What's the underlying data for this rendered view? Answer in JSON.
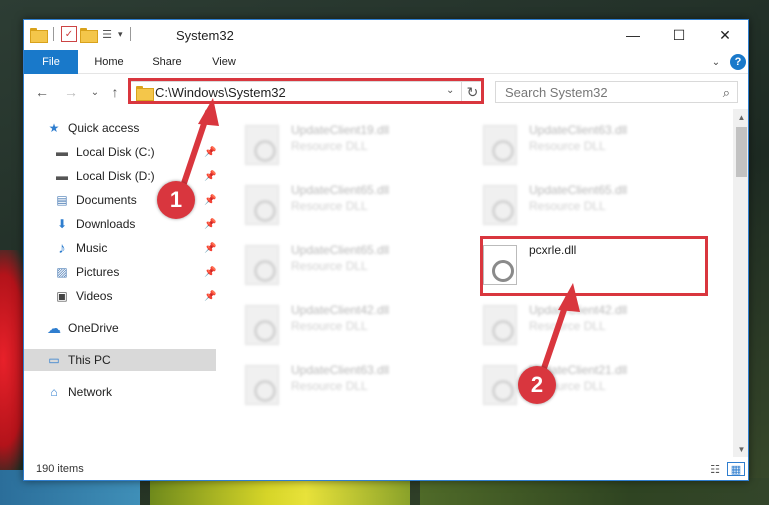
{
  "window": {
    "title": "System32",
    "controls": {
      "minimize": "—",
      "maximize": "☐",
      "close": "✕"
    }
  },
  "ribbon": {
    "tabs": [
      "File",
      "Home",
      "Share",
      "View"
    ],
    "expand": "⌄",
    "help": "?"
  },
  "navbar": {
    "back": "←",
    "forward": "→",
    "recent": "⌄",
    "up": "↑",
    "address": "C:\\Windows\\System32",
    "address_dropdown": "⌄",
    "refresh": "↻",
    "search_placeholder": "Search System32",
    "search_icon": "⌕"
  },
  "sidebar": {
    "items": [
      {
        "label": "Quick access",
        "icon": "star-icon",
        "glyph": "★",
        "color": "#2f7ecf",
        "pinned": false
      },
      {
        "label": "Local Disk (C:)",
        "icon": "disk-icon",
        "glyph": "▬",
        "color": "#555555",
        "pinned": true
      },
      {
        "label": "Local Disk (D:)",
        "icon": "disk-icon",
        "glyph": "▬",
        "color": "#555555",
        "pinned": true
      },
      {
        "label": "Documents",
        "icon": "documents-icon",
        "glyph": "▤",
        "color": "#4a7bb5",
        "pinned": true
      },
      {
        "label": "Downloads",
        "icon": "downloads-icon",
        "glyph": "⬇",
        "color": "#2f7ecf",
        "pinned": true
      },
      {
        "label": "Music",
        "icon": "music-icon",
        "glyph": "♪",
        "color": "#2f7ecf",
        "pinned": true
      },
      {
        "label": "Pictures",
        "icon": "pictures-icon",
        "glyph": "▨",
        "color": "#4a7bb5",
        "pinned": true
      },
      {
        "label": "Videos",
        "icon": "videos-icon",
        "glyph": "▣",
        "color": "#444444",
        "pinned": true
      },
      {
        "label": "OneDrive",
        "icon": "cloud-icon",
        "glyph": "☁",
        "color": "#2f7ecf",
        "pinned": false
      },
      {
        "label": "This PC",
        "icon": "computer-icon",
        "glyph": "▭",
        "color": "#2f7ecf",
        "pinned": false
      },
      {
        "label": "Network",
        "icon": "network-icon",
        "glyph": "⌂",
        "color": "#2f7ecf",
        "pinned": false
      }
    ],
    "pin_glyph": "📌"
  },
  "files": [
    {
      "name": "UpdateClient19.dll",
      "type": "Resource DLL"
    },
    {
      "name": "UpdateClient63.dll",
      "type": "Resource DLL"
    },
    {
      "name": "UpdateClient65.dll",
      "type": "Resource DLL"
    },
    {
      "name": "UpdateClient65.dll",
      "type": "Resource DLL"
    },
    {
      "name": "UpdateClient65.dll",
      "type": "Resource DLL"
    },
    {
      "name": "pcxrle.dll",
      "type": ""
    },
    {
      "name": "UpdateClient42.dll",
      "type": "Resource DLL"
    },
    {
      "name": "UpdateClient42.dll",
      "type": "Resource DLL"
    },
    {
      "name": "UpdateClient63.dll",
      "type": "Resource DLL"
    },
    {
      "name": "UpdateClient21.dll",
      "type": "Resource DLL"
    }
  ],
  "status": {
    "item_count": "190 items"
  },
  "annotations": {
    "step1": "1",
    "step2": "2",
    "color": "#d9363e"
  }
}
